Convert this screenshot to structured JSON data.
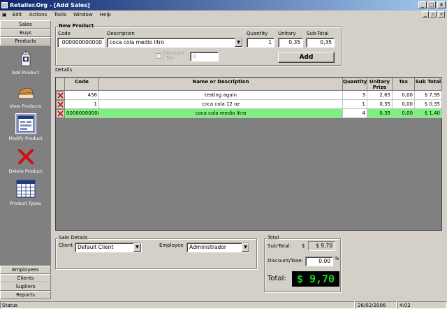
{
  "window": {
    "title": "Retailer.Org - [Add Sales]"
  },
  "menu": [
    "Edit",
    "Actions",
    "Tools",
    "Window",
    "Help"
  ],
  "sidebar": {
    "top": [
      "Sales",
      "Buys",
      "Products"
    ],
    "items": [
      {
        "label": "Add Product",
        "icon": "milk-carton-icon"
      },
      {
        "label": "View Products",
        "icon": "bread-icon"
      },
      {
        "label": "Modify Product",
        "icon": "form-icon"
      },
      {
        "label": "Delete Product",
        "icon": "red-x-icon"
      },
      {
        "label": "Product Types",
        "icon": "calendar-grid-icon"
      }
    ],
    "bottom": [
      "Employees",
      "Clients",
      "Supliers",
      "Reports"
    ]
  },
  "new_product": {
    "title": "New Product",
    "code_label": "Code",
    "code_value": "000000000000",
    "desc_label": "Description",
    "desc_value": "coca cola medio litro",
    "qty_label": "Quantity",
    "qty_value": "1",
    "unit_label": "Unitary",
    "unit_value": "0,35",
    "sub_label": "Sub-Total",
    "sub_value": "0,35",
    "discount_label": "Discount / Tax",
    "discount_value": "0",
    "add_label": "Add"
  },
  "details": {
    "label": "Details",
    "columns": [
      "Code",
      "Name or Description",
      "Quantity",
      "Unitary Prize",
      "Tax",
      "Sub Total"
    ],
    "rows": [
      {
        "code": "456",
        "name": "testing again",
        "qty": "3",
        "unit": "2,65",
        "tax": "0,00",
        "sub": "$ 7,95"
      },
      {
        "code": "1",
        "name": "coca cola 12 oz",
        "qty": "1",
        "unit": "0,35",
        "tax": "0,00",
        "sub": "$ 0,35"
      },
      {
        "code": "000000000000",
        "name": "coca cola medio litro",
        "qty": "4",
        "unit": "0,35",
        "tax": "0,00",
        "sub": "$ 1,40"
      }
    ]
  },
  "sale_details": {
    "title": "Sale Details",
    "client_label": "Client",
    "client_value": "Default Client",
    "employee_label": "Employee",
    "employee_value": "Administrador"
  },
  "total": {
    "title": "Total",
    "subtotal_label": "Sub-Total:",
    "currency": "$",
    "subtotal_value": "$ 9,70",
    "discount_label": "Discount/Taxe:",
    "discount_value": "0.00",
    "percent": "%",
    "total_label": "Total:",
    "total_display": "$ 9,70"
  },
  "status": {
    "text": "Status",
    "date": "26/02/2006",
    "time": "4:02"
  }
}
